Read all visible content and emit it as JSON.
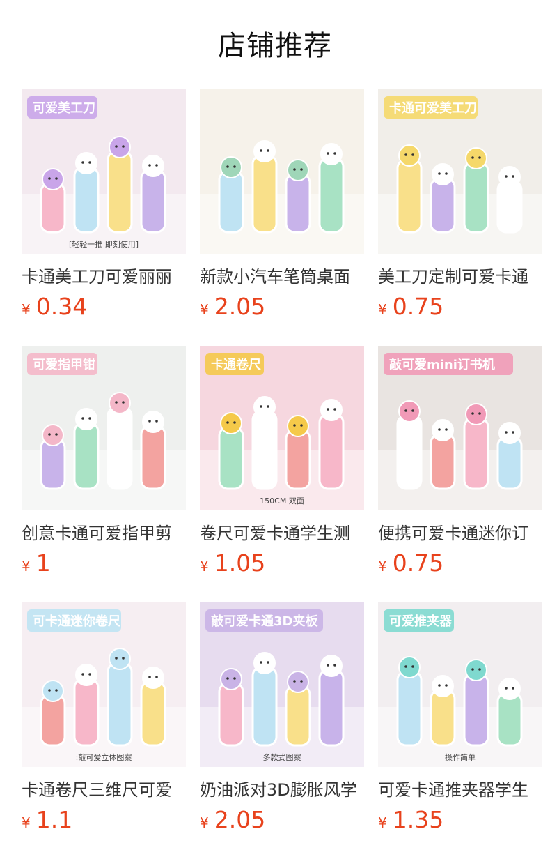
{
  "section": {
    "title": "店铺推荐"
  },
  "products": [
    {
      "name": "卡通美工刀可爱丽丽",
      "currency": "¥",
      "price": "0.34",
      "banner": "可爱美工刀",
      "caption": "[轻轻一推 即刻使用]",
      "bg": "#f3e9ef",
      "accent": "#c9a5e9"
    },
    {
      "name": "新款小汽车笔筒桌面",
      "currency": "¥",
      "price": "2.05",
      "banner": "",
      "caption": "",
      "bg": "#f6f2ea",
      "accent": "#9fd6b8"
    },
    {
      "name": "美工刀定制可爱卡通",
      "currency": "¥",
      "price": "0.75",
      "banner": "卡通可爱美工刀",
      "caption": "",
      "bg": "#f1eee9",
      "accent": "#f5d86a"
    },
    {
      "name": "创意卡通可爱指甲剪",
      "currency": "¥",
      "price": "1",
      "banner": "可爱指甲钳",
      "caption": "",
      "bg": "#eef0ee",
      "accent": "#f4b7c8"
    },
    {
      "name": "卷尺可爱卡通学生测",
      "currency": "¥",
      "price": "1.05",
      "banner": "卡通卷尺",
      "caption": "150CM 双面",
      "bg": "#f6d7df",
      "accent": "#f5c94a"
    },
    {
      "name": "便携可爱卡通迷你订",
      "currency": "¥",
      "price": "0.75",
      "banner": "敲可爱mini订书机",
      "caption": "",
      "bg": "#e9e4e1",
      "accent": "#f19ab7"
    },
    {
      "name": "卡通卷尺三维尺可爱",
      "currency": "¥",
      "price": "1.1",
      "banner": "可卡通迷你卷尺",
      "caption": ":敲可爱立体图案",
      "bg": "#f6eef2",
      "accent": "#bfe3f3"
    },
    {
      "name": "奶油派对3D膨胀风学",
      "currency": "¥",
      "price": "2.05",
      "banner": "敲可爱卡通3D夹板",
      "caption": "多款式图案",
      "bg": "#e7dcef",
      "accent": "#c9b3e6"
    },
    {
      "name": "可爱卡通推夹器学生",
      "currency": "¥",
      "price": "1.35",
      "banner": "可爱推夹器",
      "caption": "操作简单",
      "bg": "#f2eef0",
      "accent": "#7fd9cf"
    }
  ]
}
